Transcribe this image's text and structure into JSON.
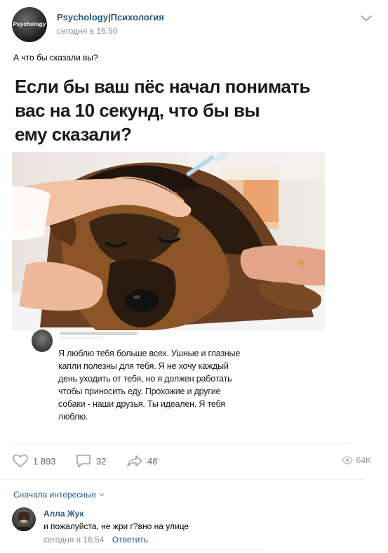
{
  "post": {
    "group_name": "Psychology|Психология",
    "avatar_label": "Psychology",
    "time": "сегодня в 16:50",
    "text": "А что бы сказали вы?"
  },
  "meme": {
    "title_line1": "Если бы ваш пёс начал понимать",
    "title_line2": "вас на 10 секунд, что бы вы",
    "title_line3": "ему сказали?",
    "comment_text": "Я люблю тебя больше всех. Ушные и глазные капли полезны для тебя. Я не хочу каждый день уходить от тебя, но я должен работать чтобы приносить еду. Прохожие и другие собаки - наши друзья. Ты идеален. Я тебя люблю."
  },
  "actions": {
    "likes": "1 893",
    "comments": "32",
    "shares": "48",
    "views": "64K"
  },
  "comments": {
    "sort_label": "Сначала интересные",
    "items": [
      {
        "author": "Алла Жук",
        "text": "и пожалуйста, не жри г?вно на улице",
        "time": "сегодня в 16:54",
        "reply_label": "Ответить"
      }
    ]
  },
  "colors": {
    "link": "#2a5885",
    "secondary_text": "#939393",
    "icon": "#99a2ad"
  },
  "icons": [
    "chevron-down-icon",
    "heart-icon",
    "comment-icon",
    "share-icon",
    "eye-icon"
  ]
}
